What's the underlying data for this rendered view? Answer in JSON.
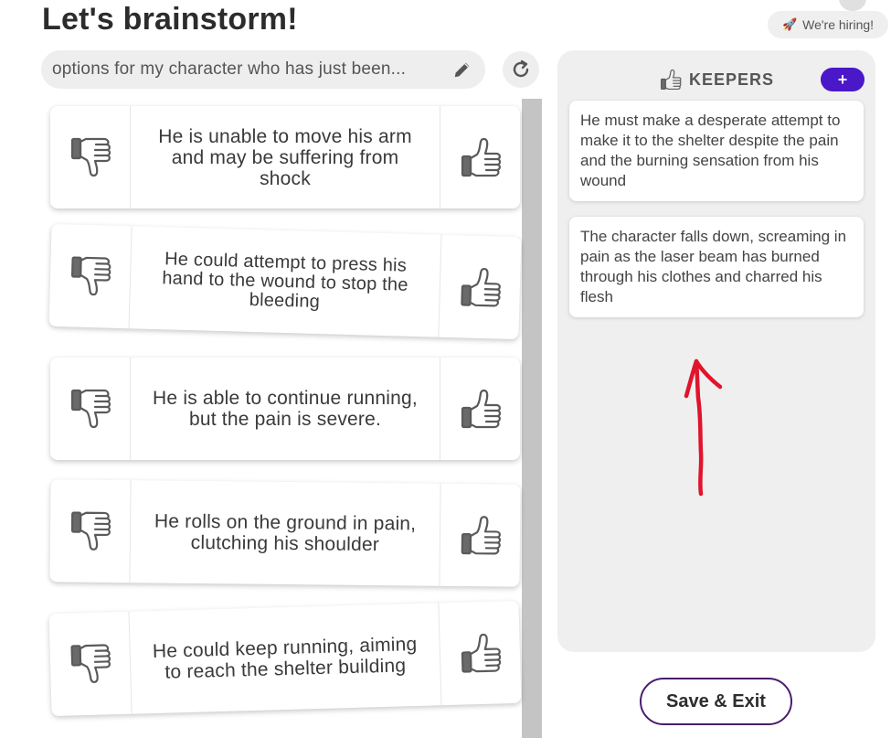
{
  "page": {
    "title": "Let's brainstorm!"
  },
  "hiring": {
    "label": "We're hiring!",
    "icon": "rocket-icon"
  },
  "prompt": {
    "text": "options for my character who has just been...",
    "edit_icon": "pencil-icon",
    "refresh_icon": "refresh-icon"
  },
  "ideas": [
    {
      "text": "He is unable to move his arm and may be suffering from shock"
    },
    {
      "text": "He could attempt to press his hand to the wound to stop the bleeding"
    },
    {
      "text": "He is able to continue running, but the pain is severe."
    },
    {
      "text": "He rolls on the ground in pain, clutching his shoulder"
    },
    {
      "text": "He could keep running, aiming to reach the shelter building"
    }
  ],
  "keepers": {
    "title": "KEEPERS",
    "add_label": "+",
    "items": [
      {
        "text": "He must make a desperate attempt to make it to the shelter despite the pain and the burning sensation from his wound"
      },
      {
        "text": "The character falls down, screaming in pain as the laser beam has burned through his clothes and charred his flesh"
      }
    ]
  },
  "actions": {
    "save_exit": "Save & Exit"
  },
  "colors": {
    "accent_purple": "#4a17c9",
    "save_border": "#4a1d6e",
    "annotation_red": "#e0142c",
    "panel_gray": "#efefef"
  }
}
